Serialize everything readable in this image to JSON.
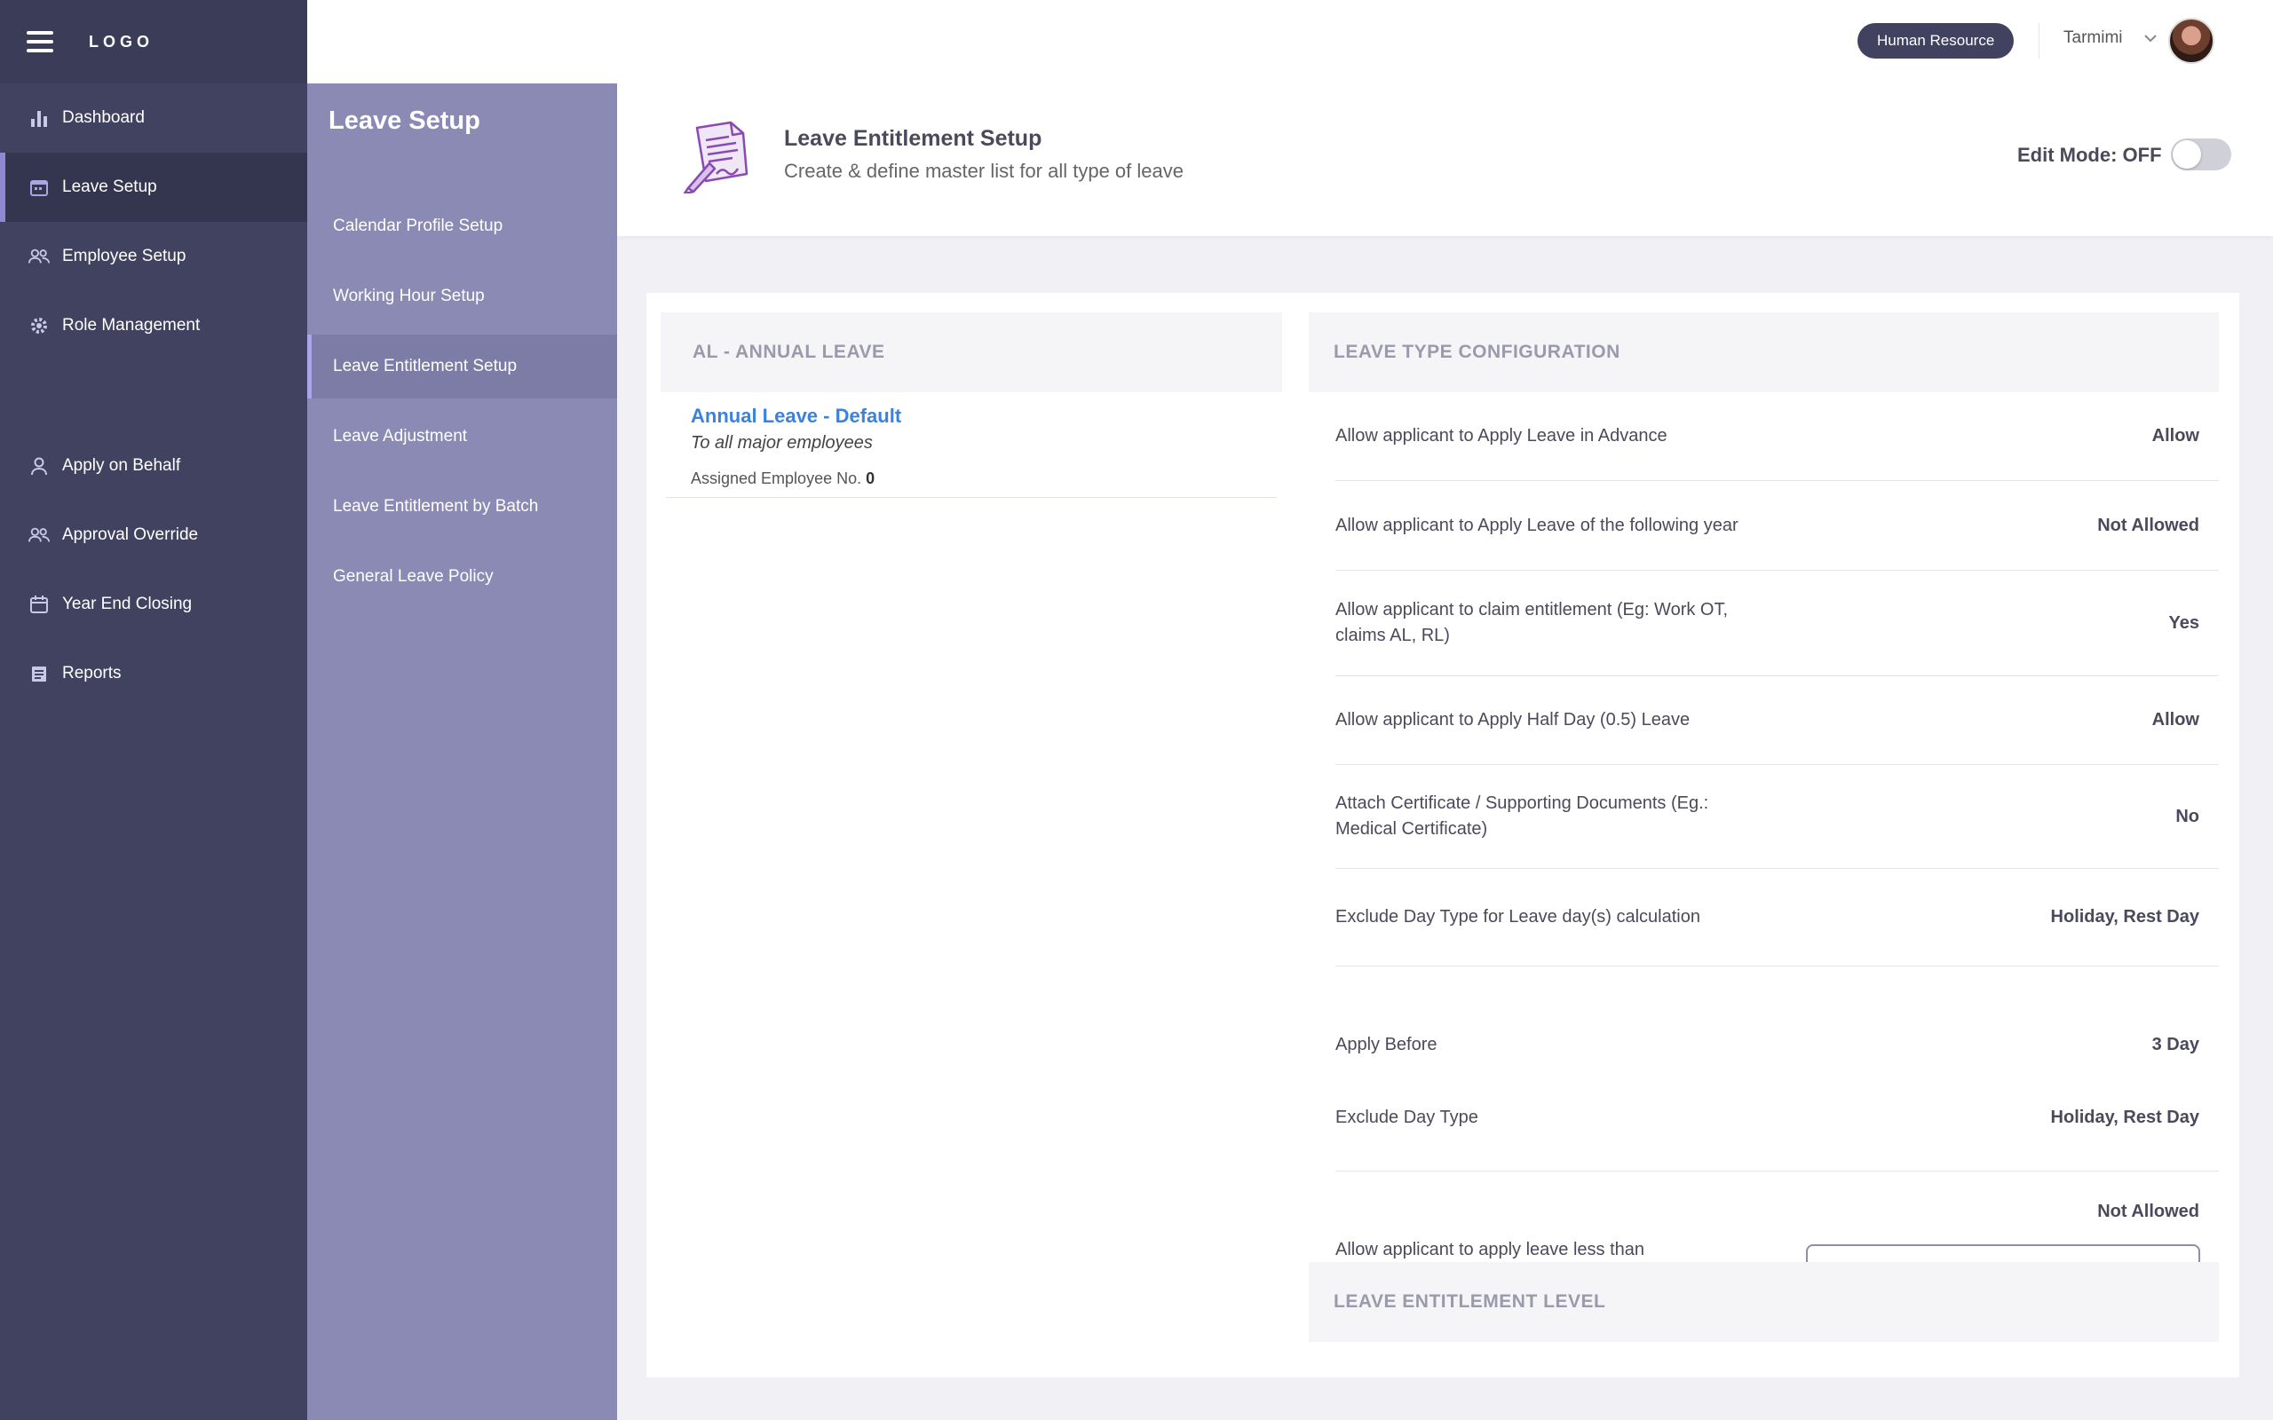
{
  "sidebar": {
    "logo": "LOGO",
    "items": [
      {
        "label": "Dashboard",
        "icon": "bar-chart-icon"
      },
      {
        "label": "Leave Setup",
        "icon": "calendar-icon",
        "active": true
      },
      {
        "label": "Employee Setup",
        "icon": "users-icon"
      },
      {
        "label": "Role Management",
        "icon": "gear-icon"
      },
      {
        "label": "Apply on Behalf",
        "icon": "user-icon"
      },
      {
        "label": "Approval Override",
        "icon": "users-icon"
      },
      {
        "label": "Year End Closing",
        "icon": "calendar-icon"
      },
      {
        "label": "Reports",
        "icon": "document-icon"
      }
    ]
  },
  "subsidebar": {
    "title": "Leave Setup",
    "items": [
      {
        "label": "Calendar Profile Setup"
      },
      {
        "label": "Working Hour Setup"
      },
      {
        "label": "Leave Entitlement Setup",
        "active": true
      },
      {
        "label": "Leave Adjustment"
      },
      {
        "label": "Leave Entitlement by Batch"
      },
      {
        "label": "General Leave Policy"
      }
    ]
  },
  "header": {
    "role": "Human Resource",
    "user_name": "Tarmimi"
  },
  "page": {
    "title": "Leave Entitlement Setup",
    "subtitle": "Create & define master list for all type of leave",
    "edit_mode_label": "Edit Mode: OFF",
    "edit_mode_on": false
  },
  "left_panel": {
    "heading": "AL - ANNUAL LEAVE",
    "item": {
      "name": "Annual Leave - Default",
      "description": "To all major employees",
      "assigned_label": "Assigned Employee No.",
      "assigned_count": "0"
    }
  },
  "config": {
    "heading": "LEAVE TYPE CONFIGURATION",
    "rows": [
      {
        "label": "Allow applicant to Apply Leave in Advance",
        "value": "Allow"
      },
      {
        "label": "Allow applicant to Apply Leave of the following year",
        "value": "Not Allowed"
      },
      {
        "label": "Allow applicant to claim entitlement (Eg: Work OT, claims AL, RL)",
        "value": "Yes"
      },
      {
        "label": "Allow applicant to Apply Half Day (0.5) Leave",
        "value": "Allow"
      },
      {
        "label": "Attach Certificate / Supporting Documents (Eg.: Medical Certificate)",
        "value": "No"
      },
      {
        "label": "Exclude Day Type for Leave day(s) calculation",
        "value": "Holiday, Rest Day"
      },
      {
        "label": "Apply Before",
        "value": "3 Day"
      },
      {
        "label": "Exclude Day Type",
        "value": "Holiday, Rest Day"
      },
      {
        "label": "Allow applicant to apply leave less than",
        "value": "Not Allowed"
      }
    ],
    "bottom_heading": "LEAVE ENTITLEMENT LEVEL"
  },
  "colors": {
    "sidebar": "#41425f",
    "subsidebar": "#8b8ab5",
    "link": "#3b82e0",
    "accent": "#8f89d3"
  }
}
